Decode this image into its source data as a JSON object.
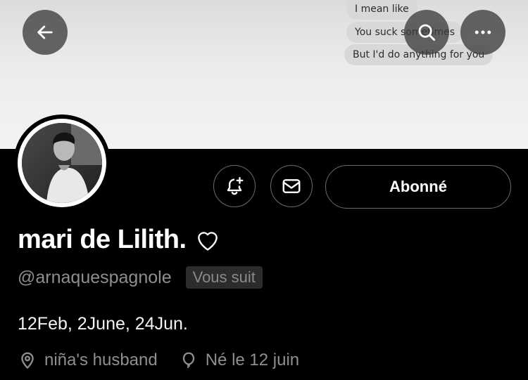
{
  "banner": {
    "messages": [
      "I mean like",
      "You suck sometimes",
      "But I'd do anything for you"
    ]
  },
  "toolbar": {
    "back_icon": "arrow-left-icon",
    "search_icon": "search-icon",
    "more_icon": "more-horizontal-icon"
  },
  "actions": {
    "notify_icon": "bell-plus-icon",
    "message_icon": "mail-icon",
    "follow_label": "Abonné"
  },
  "profile": {
    "display_name": "mari de Lilith.",
    "name_emoji_icon": "white-heart-icon",
    "handle": "@arnaquespagnole",
    "follows_you": "Vous suit",
    "bio": "12Feb, 2June, 24Jun.",
    "location": "niña's husband",
    "birthday": "Né le 12 juin"
  },
  "colors": {
    "background": "#000000",
    "secondary_text": "#8e8e8e",
    "banner_bubble": "#d8d8d8"
  }
}
